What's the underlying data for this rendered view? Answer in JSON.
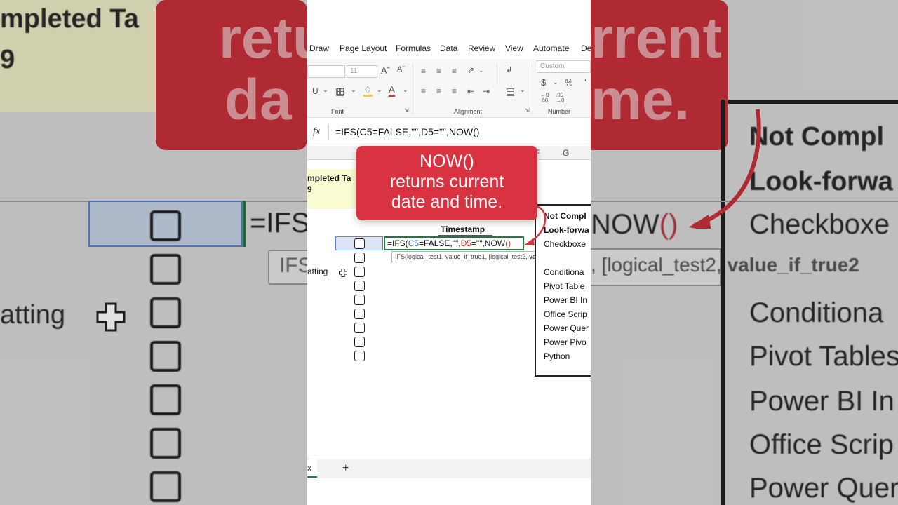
{
  "menu": {
    "items": [
      "Draw",
      "Page Layout",
      "Formulas",
      "Data",
      "Review",
      "View",
      "Automate",
      "De"
    ]
  },
  "ribbon": {
    "font_size": "11",
    "number_format": "Custom",
    "group_font": "Font",
    "group_alignment": "Alignment",
    "group_number": "Number",
    "currency_symbol": "$",
    "percent_symbol": "%"
  },
  "formula_bar": {
    "fx": "fx",
    "formula": "=IFS(C5=FALSE,\"\",D5=\"\",NOW()"
  },
  "columns": {
    "f": "F",
    "g": "G"
  },
  "grid": {
    "header_line1": "mpleted Ta",
    "header_line2": "9",
    "timestamp_label": "Timestamp",
    "side_text": "atting",
    "edit_parts": [
      "=IFS(",
      "C5",
      "=FALSE,\"\",",
      "D5",
      "=\"\",NOW",
      "()"
    ],
    "tooltip_plain": "IFS(logical_test1, value_if_true1, [logical_test2, ",
    "tooltip_bold": "value_if_true2",
    "list_header1": "Not Compl",
    "list_header2": "Look-forwa",
    "list_items": [
      "Checkboxe",
      "",
      "Conditiona",
      "Pivot Table",
      "Power BI In",
      "Office Scrip",
      "Power Quer",
      "Power Pivo",
      "Python"
    ]
  },
  "callout": {
    "line1": "NOW()",
    "line2": "returns current",
    "line3": "date and time."
  },
  "sheets": {
    "active_tab": "x",
    "add": "+"
  },
  "colors": {
    "callout_red": "#d93241",
    "excel_green": "#1f7a3c",
    "ref_blue": "#2f6fd0",
    "ref_red": "#c0392b",
    "header_yellow": "#fbfbd2"
  },
  "background_left": {
    "header1": "mpleted Ta",
    "header2": "9",
    "formula": "=IFS",
    "tooltip": "IFS",
    "side_text": "atting",
    "banner_line1": "retu",
    "banner_line2": "da"
  },
  "background_right": {
    "banner_line1": "rrent",
    "banner_line2": "me.",
    "now_text": "NOW",
    "now_parens": "()",
    "header1": "Not Compl",
    "header2": "Look-forwa",
    "items": [
      "Checkboxe",
      "Conditiona",
      "Pivot Tables",
      "Power BI In",
      "Office Scrip",
      "Power Quer"
    ],
    "tooltip_plain": ", [logical_test2, ",
    "tooltip_bold": "value_if_true2"
  }
}
